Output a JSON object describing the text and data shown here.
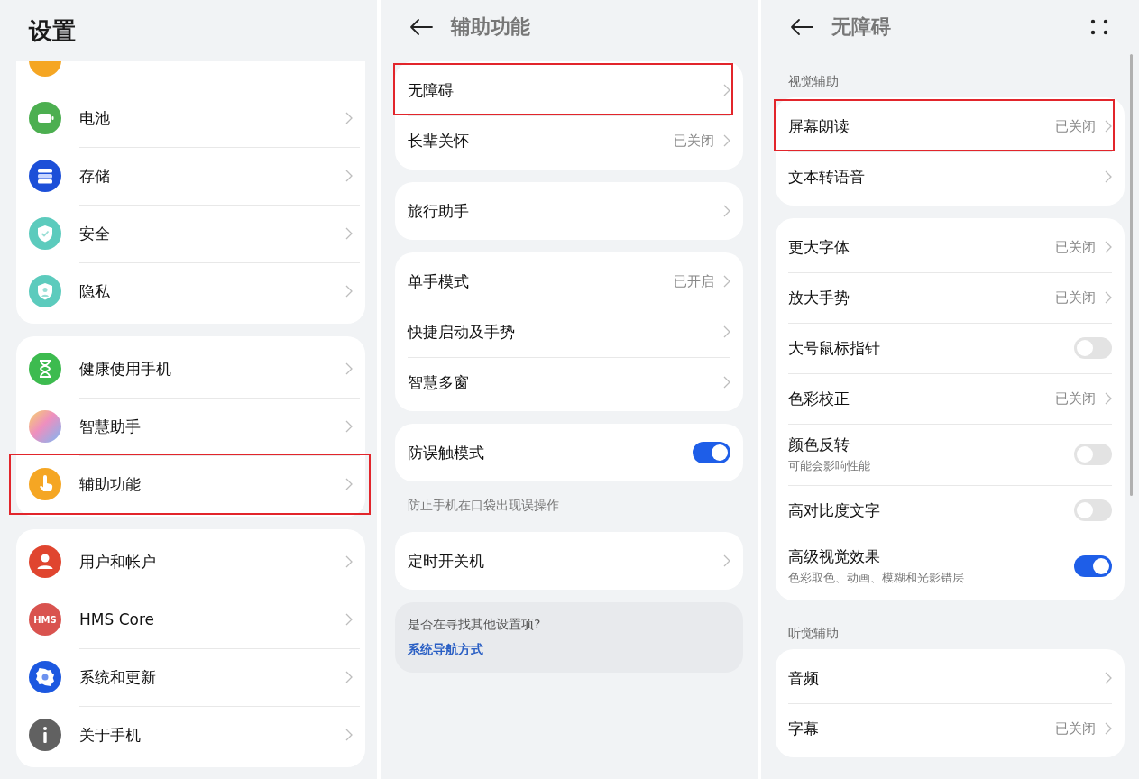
{
  "panels": [
    {
      "header": {
        "kind": "root",
        "title": "设置"
      },
      "groups": [
        {
          "kind": "list",
          "items": [
            {
              "kind": "cut"
            },
            {
              "kind": "link",
              "label": "电池"
            },
            {
              "kind": "link",
              "label": "存储"
            },
            {
              "kind": "link",
              "label": "安全"
            },
            {
              "kind": "link",
              "label": "隐私"
            }
          ]
        },
        {
          "kind": "list",
          "items": [
            {
              "kind": "link",
              "label": "健康使用手机"
            },
            {
              "kind": "link",
              "label": "智慧助手"
            },
            {
              "kind": "link",
              "label": "辅助功能",
              "highlighted": true
            }
          ]
        },
        {
          "kind": "list",
          "items": [
            {
              "kind": "link",
              "label": "用户和帐户"
            },
            {
              "kind": "link",
              "label": "HMS Core",
              "icon_text": "HMS"
            },
            {
              "kind": "link",
              "label": "系统和更新"
            },
            {
              "kind": "link",
              "label": "关于手机"
            }
          ]
        }
      ]
    },
    {
      "header": {
        "kind": "sub",
        "title": "辅助功能"
      },
      "groups": [
        {
          "kind": "list",
          "items": [
            {
              "kind": "link",
              "label": "无障碍",
              "highlighted": true
            },
            {
              "kind": "link",
              "label": "长辈关怀",
              "value": "已关闭"
            }
          ]
        },
        {
          "kind": "list",
          "items": [
            {
              "kind": "link",
              "label": "旅行助手"
            }
          ]
        },
        {
          "kind": "list",
          "items": [
            {
              "kind": "link",
              "label": "单手模式",
              "value": "已开启"
            },
            {
              "kind": "link",
              "label": "快捷启动及手势"
            },
            {
              "kind": "link",
              "label": "智慧多窗"
            }
          ]
        },
        {
          "kind": "list",
          "items": [
            {
              "kind": "toggle",
              "label": "防误触模式",
              "on": true
            }
          ],
          "note": "防止手机在口袋出现误操作"
        },
        {
          "kind": "list",
          "items": [
            {
              "kind": "link",
              "label": "定时开关机"
            }
          ]
        },
        {
          "kind": "hint",
          "text": "是否在寻找其他设置项?",
          "link": "系统导航方式"
        }
      ]
    },
    {
      "header": {
        "kind": "sub",
        "title": "无障碍",
        "more": true
      },
      "scrollbar": true,
      "groups": [
        {
          "kind": "list",
          "section": "视觉辅助",
          "items": [
            {
              "kind": "link",
              "label": "屏幕朗读",
              "value": "已关闭",
              "highlighted": true
            },
            {
              "kind": "link",
              "label": "文本转语音"
            }
          ]
        },
        {
          "kind": "list",
          "items": [
            {
              "kind": "link",
              "label": "更大字体",
              "value": "已关闭"
            },
            {
              "kind": "link",
              "label": "放大手势",
              "value": "已关闭"
            },
            {
              "kind": "toggle",
              "label": "大号鼠标指针",
              "on": false
            },
            {
              "kind": "link",
              "label": "色彩校正",
              "value": "已关闭"
            },
            {
              "kind": "toggle",
              "label": "颜色反转",
              "sub": "可能会影响性能",
              "on": false
            },
            {
              "kind": "toggle",
              "label": "高对比度文字",
              "on": false
            },
            {
              "kind": "toggle",
              "label": "高级视觉效果",
              "sub": "色彩取色、动画、模糊和光影错层",
              "on": true
            }
          ]
        },
        {
          "kind": "list",
          "section": "听觉辅助",
          "items": [
            {
              "kind": "link",
              "label": "音频"
            },
            {
              "kind": "link",
              "label": "字幕",
              "value": "已关闭"
            }
          ]
        }
      ]
    }
  ]
}
